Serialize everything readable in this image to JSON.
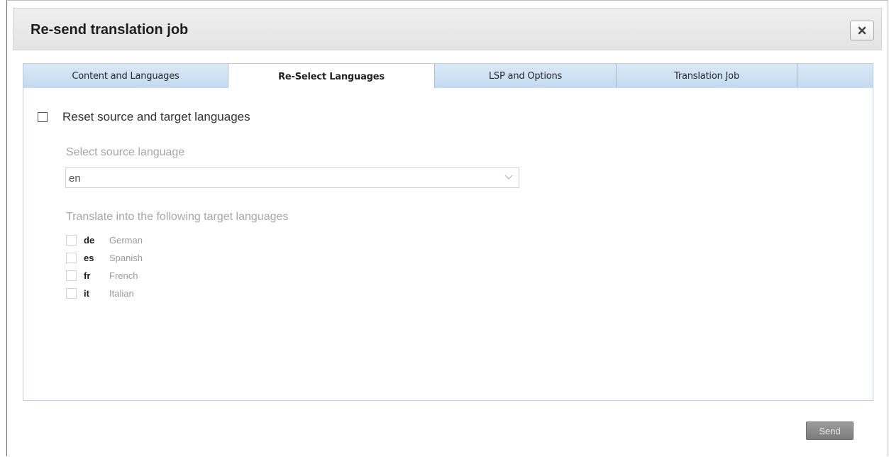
{
  "dialog": {
    "title": "Re-send translation job",
    "close_icon": "close-x-icon"
  },
  "tabs": [
    {
      "label": "Content and Languages",
      "active": false
    },
    {
      "label": "Re-Select Languages",
      "active": true
    },
    {
      "label": "LSP and Options",
      "active": false
    },
    {
      "label": "Translation Job",
      "active": false
    }
  ],
  "reset": {
    "label": "Reset source and target languages",
    "checked": false
  },
  "source": {
    "label": "Select source language",
    "value": "en",
    "chevron_icon": "chevron-down-icon"
  },
  "targets": {
    "label": "Translate into the following target languages",
    "languages": [
      {
        "code": "de",
        "name": "German",
        "checked": false
      },
      {
        "code": "es",
        "name": "Spanish",
        "checked": false
      },
      {
        "code": "fr",
        "name": "French",
        "checked": false
      },
      {
        "code": "it",
        "name": "Italian",
        "checked": false
      }
    ]
  },
  "footer": {
    "send_label": "Send"
  }
}
